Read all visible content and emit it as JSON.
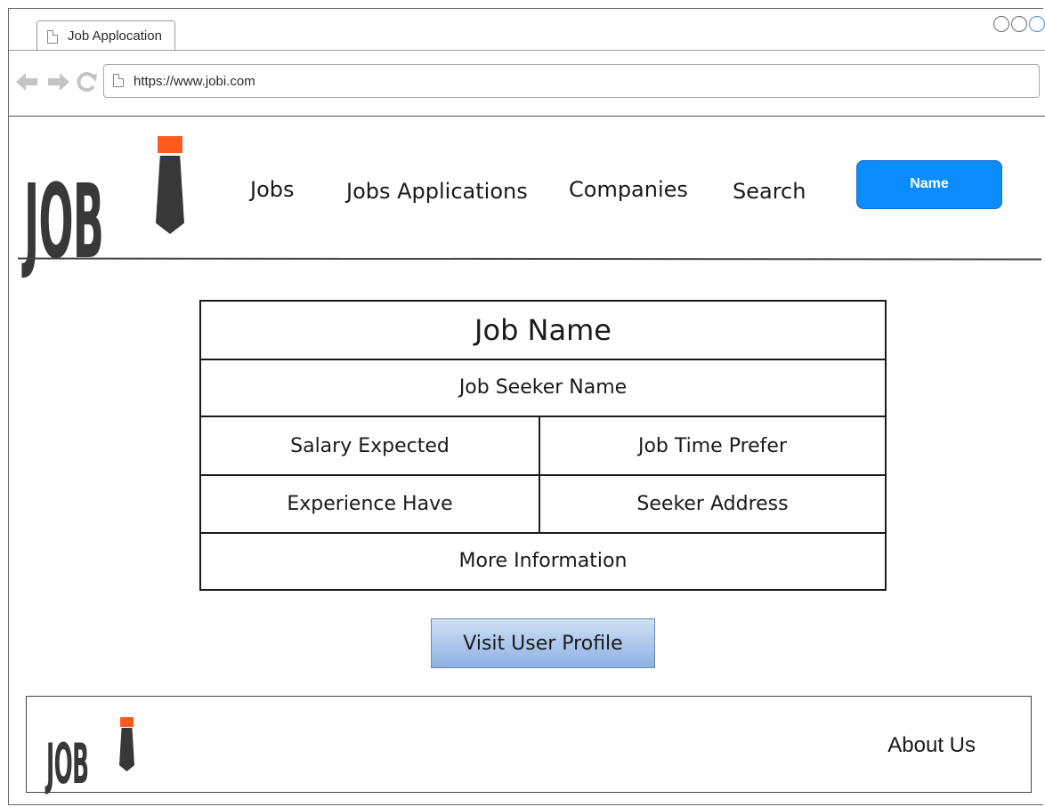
{
  "browser": {
    "tab_title": "Job Applocation",
    "url": "https://www.jobi.com",
    "back_icon": "arrow-left-icon",
    "forward_icon": "arrow-right-icon",
    "reload_icon": "reload-icon"
  },
  "header": {
    "logo_text": "JOB",
    "nav": {
      "jobs": "Jobs",
      "applications": "Jobs Applications",
      "companies": "Companies",
      "search": "Search"
    },
    "user_button": "Name",
    "accent_color": "#0b8cff",
    "logo_tie_color": "#ff5a1e"
  },
  "job_card": {
    "title": "Job Name",
    "seeker_name": "Job Seeker Name",
    "salary": "Salary Expected",
    "time_prefer": "Job Time Prefer",
    "experience": "Experience Have",
    "address": "Seeker Address",
    "more_info": "More Information"
  },
  "actions": {
    "visit_profile": "Visit User Profile"
  },
  "footer": {
    "logo_text": "JOB",
    "about": "About Us"
  }
}
